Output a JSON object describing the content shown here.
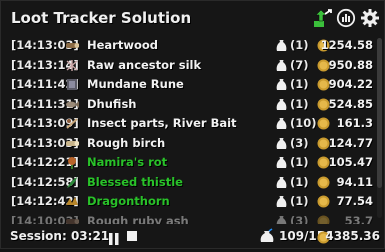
{
  "header": {
    "title": "Loot Tracker Solution",
    "icons": [
      "export-icon",
      "stats-icon",
      "settings-icon"
    ]
  },
  "rows": [
    {
      "time": "[14:13:03]",
      "icon": "wood-log-icon",
      "name": "Heartwood",
      "name_color": "white",
      "qty": "(1)",
      "value": "1254.58"
    },
    {
      "time": "[14:13:14]",
      "icon": "silk-icon",
      "name": "Raw ancestor silk",
      "name_color": "white",
      "qty": "(7)",
      "value": "950.88"
    },
    {
      "time": "[14:11:42]",
      "icon": "rune-icon",
      "name": "Mundane Rune",
      "name_color": "white",
      "qty": "(1)",
      "value": "904.22"
    },
    {
      "time": "[14:11:31]",
      "icon": "fish-icon",
      "name": "Dhufish",
      "name_color": "white",
      "qty": "(1)",
      "value": "524.85"
    },
    {
      "time": "[14:13:09]",
      "icon": "insect-bait-icon",
      "name": "Insect parts, River Bait",
      "name_color": "white",
      "qty": "(10)",
      "value": "161.3"
    },
    {
      "time": "[14:13:03]",
      "icon": "birch-log-icon",
      "name": "Rough birch",
      "name_color": "white",
      "qty": "(3)",
      "value": "124.77"
    },
    {
      "time": "[14:12:21]",
      "icon": "herb-icon",
      "name": "Namira's rot",
      "name_color": "green",
      "qty": "(1)",
      "value": "105.47"
    },
    {
      "time": "[14:12:58]",
      "icon": "thistle-icon",
      "name": "Blessed thistle",
      "name_color": "green",
      "qty": "(1)",
      "value": "94.11"
    },
    {
      "time": "[14:12:42]",
      "icon": "dragonthorn-icon",
      "name": "Dragonthorn",
      "name_color": "green",
      "qty": "(1)",
      "value": "77.54"
    },
    {
      "time": "[14:10:03]",
      "icon": "ash-log-icon",
      "name": "Rough ruby ash",
      "name_color": "white",
      "qty": "(3)",
      "value": "53.7"
    }
  ],
  "footer": {
    "session_label": "Session: 03:21",
    "inventory": "109/150",
    "total_value": "4385.36"
  },
  "colors": {
    "background": "#161616",
    "text": "#f2f2f2",
    "green_item": "#29c229",
    "gold": "#d4a431",
    "export_green": "#3bbf3b"
  }
}
